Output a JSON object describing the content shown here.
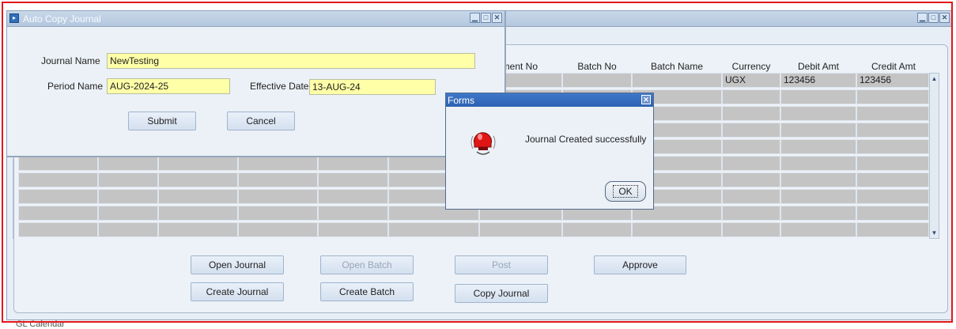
{
  "main_window": {
    "columns": {
      "document_no": "cument No",
      "batch_no": "Batch No",
      "batch_name": "Batch Name",
      "currency": "Currency",
      "debit_amt": "Debit Amt",
      "credit_amt": "Credit Amt"
    },
    "first_row": {
      "currency": "UGX",
      "debit_amt": "123456",
      "credit_amt": "123456"
    },
    "buttons": {
      "open_journal": "Open Journal",
      "open_batch": "Open Batch",
      "post": "Post",
      "approve": "Approve",
      "create_journal": "Create Journal",
      "create_batch": "Create Batch",
      "copy_journal": "Copy Journal"
    },
    "bottom_text": "GL Calendar"
  },
  "auto_copy_dialog": {
    "title": "Auto Copy Journal",
    "journal_name_label": "Journal Name",
    "journal_name_value": "NewTesting",
    "period_name_label": "Period Name",
    "period_name_value": "AUG-2024-25",
    "effective_date_label": "Effective Date",
    "effective_date_value": "13-AUG-24",
    "submit_label": "Submit",
    "cancel_label": "Cancel"
  },
  "forms_dialog": {
    "title": "Forms",
    "message": "Journal Created successfully",
    "ok_label": "OK",
    "icon": "alert-bell-icon"
  },
  "colors": {
    "titlebar": "#b3c7de",
    "field_yellow": "#ffffa8",
    "row_gray": "#c4c4c4",
    "forms_title": "#2e62b2",
    "frame_red": "#e3161b"
  }
}
